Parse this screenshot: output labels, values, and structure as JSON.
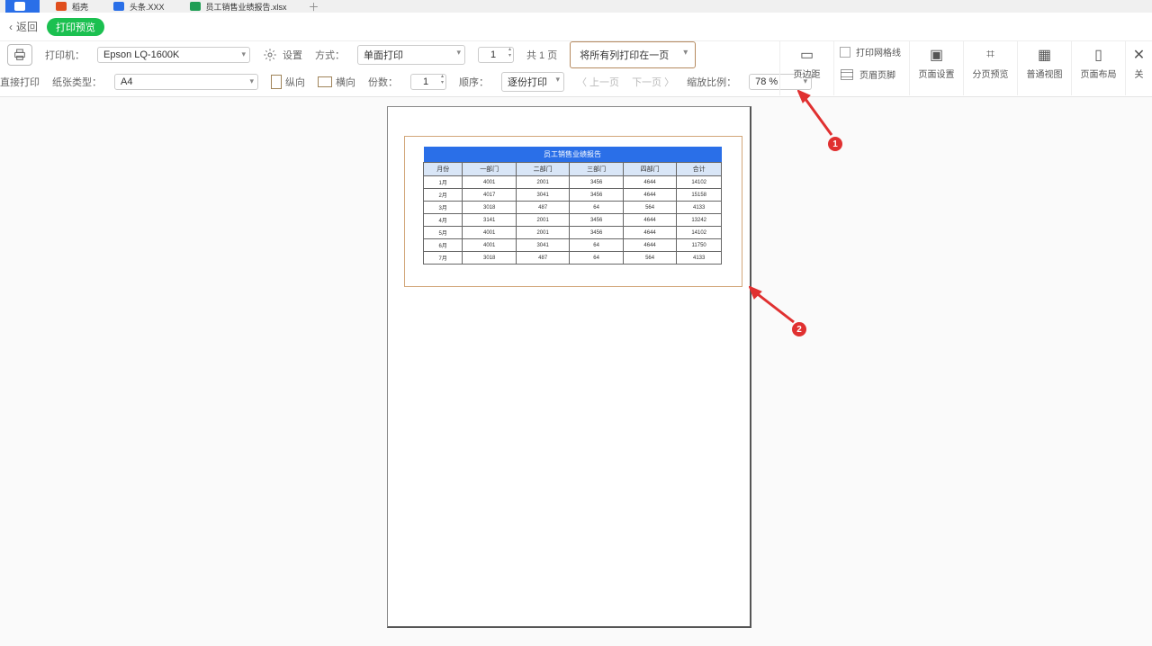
{
  "tabs": {
    "t1": "",
    "t2": "稻壳",
    "t3": "头条.XXX",
    "t4": "员工销售业绩报告.xlsx"
  },
  "back": {
    "label": "返回",
    "badge": "打印预览"
  },
  "row1": {
    "printer_lbl": "打印机：",
    "printer": "Epson LQ-1600K",
    "settings": "设置",
    "mode_lbl": "方式：",
    "mode": "单面打印",
    "copies": "1",
    "pages_lbl": "共 1 页",
    "scale_option": "将所有列打印在一页"
  },
  "row2": {
    "direct_lbl": "直接打印",
    "paper_lbl": "纸张类型：",
    "paper": "A4",
    "portrait": "纵向",
    "landscape": "横向",
    "copies_lbl": "份数：",
    "copies": "1",
    "order_lbl": "顺序：",
    "order": "逐份打印",
    "prev": "〈 上一页",
    "next": "下一页 〉",
    "zoom_lbl": "缩放比例：",
    "zoom": "78 %"
  },
  "right": {
    "c1": {
      "ic": "▭",
      "tx": "页边距"
    },
    "c1b": {
      "tx1": "打印网格线",
      "tx2": "页眉页脚"
    },
    "c2": {
      "ic": "▣",
      "tx": "页面设置"
    },
    "c3": {
      "ic": "⌗",
      "tx": "分页预览"
    },
    "c4": {
      "ic": "▦",
      "tx": "普通视图"
    },
    "c5": {
      "ic": "▯",
      "tx": "页面布局"
    },
    "c6": {
      "ic": "✕",
      "tx": "关"
    }
  },
  "chart_data": {
    "type": "table",
    "title": "员工销售业绩报告",
    "headers": [
      "月份",
      "一部门",
      "二部门",
      "三部门",
      "四部门",
      "合计"
    ],
    "rows": [
      [
        "1月",
        "4001",
        "2001",
        "3456",
        "4644",
        "14102"
      ],
      [
        "2月",
        "4017",
        "3041",
        "3456",
        "4644",
        "15158"
      ],
      [
        "3月",
        "3018",
        "487",
        "64",
        "564",
        "4133"
      ],
      [
        "4月",
        "3141",
        "2001",
        "3456",
        "4644",
        "13242"
      ],
      [
        "5月",
        "4001",
        "2001",
        "3456",
        "4644",
        "14102"
      ],
      [
        "6月",
        "4001",
        "3041",
        "64",
        "4644",
        "11750"
      ],
      [
        "7月",
        "3018",
        "487",
        "64",
        "564",
        "4133"
      ]
    ]
  },
  "anno": {
    "n1": "1",
    "n2": "2"
  }
}
